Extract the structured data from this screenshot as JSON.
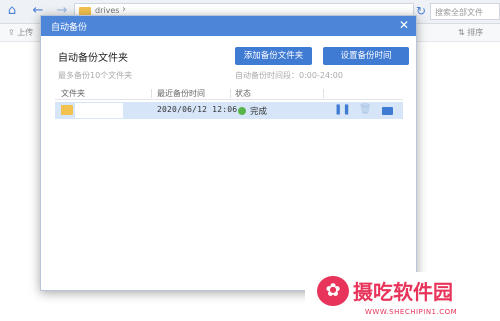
{
  "toolbar": {
    "path_text": "drives",
    "search_placeholder": "搜索全部文件",
    "upload_label": "上传",
    "sort_label": "排序"
  },
  "dialog": {
    "title": "自动备份",
    "section_title": "自动备份文件夹",
    "add_button": "添加备份文件夹",
    "time_button": "设置备份时间",
    "hint_max": "最多备份10个文件夹",
    "hint_range": "自动备份时间段：0:00-24:00",
    "columns": [
      "文件夹",
      "最近备份时间",
      "状态"
    ],
    "rows": [
      {
        "time": "2020/06/12 12:06",
        "status": "完成"
      }
    ]
  },
  "watermark": {
    "brand": "摄吃软件园",
    "url": "WWW.SHECHIPIN1.COM"
  },
  "colors": {
    "accent": "#4d86d9",
    "button": "#3f7ad3",
    "row_selected": "#d6e6f8",
    "status_ok": "#59b54b",
    "watermark": "#e8345a"
  }
}
